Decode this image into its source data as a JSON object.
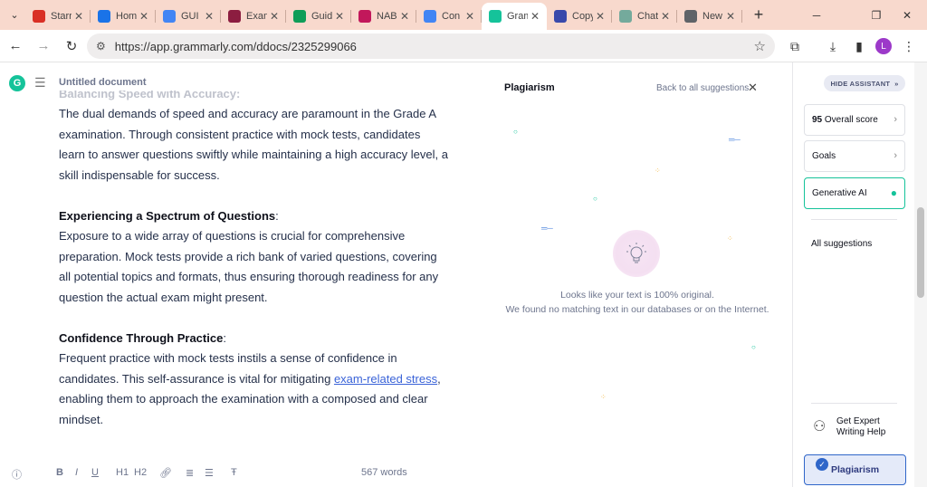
{
  "tabs": [
    {
      "title": "Starred",
      "icon": "gmail-icon",
      "color": "#d93025"
    },
    {
      "title": "Home",
      "icon": "drive-icon",
      "color": "#1a73e8"
    },
    {
      "title": "GUI",
      "icon": "docs-icon",
      "color": "#4285f4"
    },
    {
      "title": "Exam",
      "icon": "exam-icon",
      "color": "#8c1d40"
    },
    {
      "title": "Guide",
      "icon": "sheets-icon",
      "color": "#0f9d58"
    },
    {
      "title": "NABE",
      "icon": "nab-icon",
      "color": "#c2185b"
    },
    {
      "title": "Con",
      "icon": "docs-icon",
      "color": "#4285f4"
    },
    {
      "title": "Grammarly",
      "icon": "grammarly-icon",
      "color": "#15c39a",
      "active": true
    },
    {
      "title": "Copy",
      "icon": "copy-icon",
      "color": "#3949ab"
    },
    {
      "title": "Chat",
      "icon": "chatgpt-icon",
      "color": "#74aa9c"
    },
    {
      "title": "New",
      "icon": "chrome-icon",
      "color": "#5f6368"
    }
  ],
  "toolbar": {
    "url": "https://app.grammarly.com/ddocs/2325299066",
    "avatar": "L"
  },
  "doc": {
    "title": "Untitled document",
    "faded_heading": "Balancing Speed with Accuracy:",
    "p1": "The dual demands of speed and accuracy are paramount in the Grade A examination. Through consistent practice with mock tests, candidates learn to answer questions swiftly while maintaining a high accuracy level, a skill indispensable for success.",
    "h2": "Experiencing a Spectrum of Questions",
    "p2": "Exposure to a wide array of questions is crucial for comprehensive preparation. Mock tests provide a rich bank of varied questions, covering all potential topics and formats, thus ensuring thorough readiness for any question the actual exam might present.",
    "h3": "Confidence Through Practice",
    "p3_before": "Frequent practice with mock tests instils a sense of confidence in candidates. This self-assurance is vital for mitigating ",
    "p3_link": "exam-related stress",
    "p3_after": ", enabling them to approach the examination with a composed and clear mindset.",
    "colon": ":",
    "word_count": "567 words",
    "format_buttons": [
      "B",
      "I",
      "U",
      "H1",
      "H2"
    ]
  },
  "plagiarism": {
    "title": "Plagiarism",
    "back_label": "Back to all suggestions",
    "msg1": "Looks like your text is 100% original.",
    "msg2": "We found no matching text in our databases or on the Internet."
  },
  "assistant": {
    "hide_label": "HIDE ASSISTANT",
    "score_value": "95",
    "score_label": "Overall score",
    "goals_label": "Goals",
    "genai_label": "Generative AI",
    "all_suggestions": "All suggestions",
    "expert_label": "Get Expert Writing Help",
    "plagiarism_label": "Plagiarism"
  },
  "colors": {
    "tabbar_bg": "#f8d9cd",
    "grammarly_green": "#15c39a",
    "plagiarism_blue": "#2f66c9",
    "link_blue": "#3a63d8"
  }
}
